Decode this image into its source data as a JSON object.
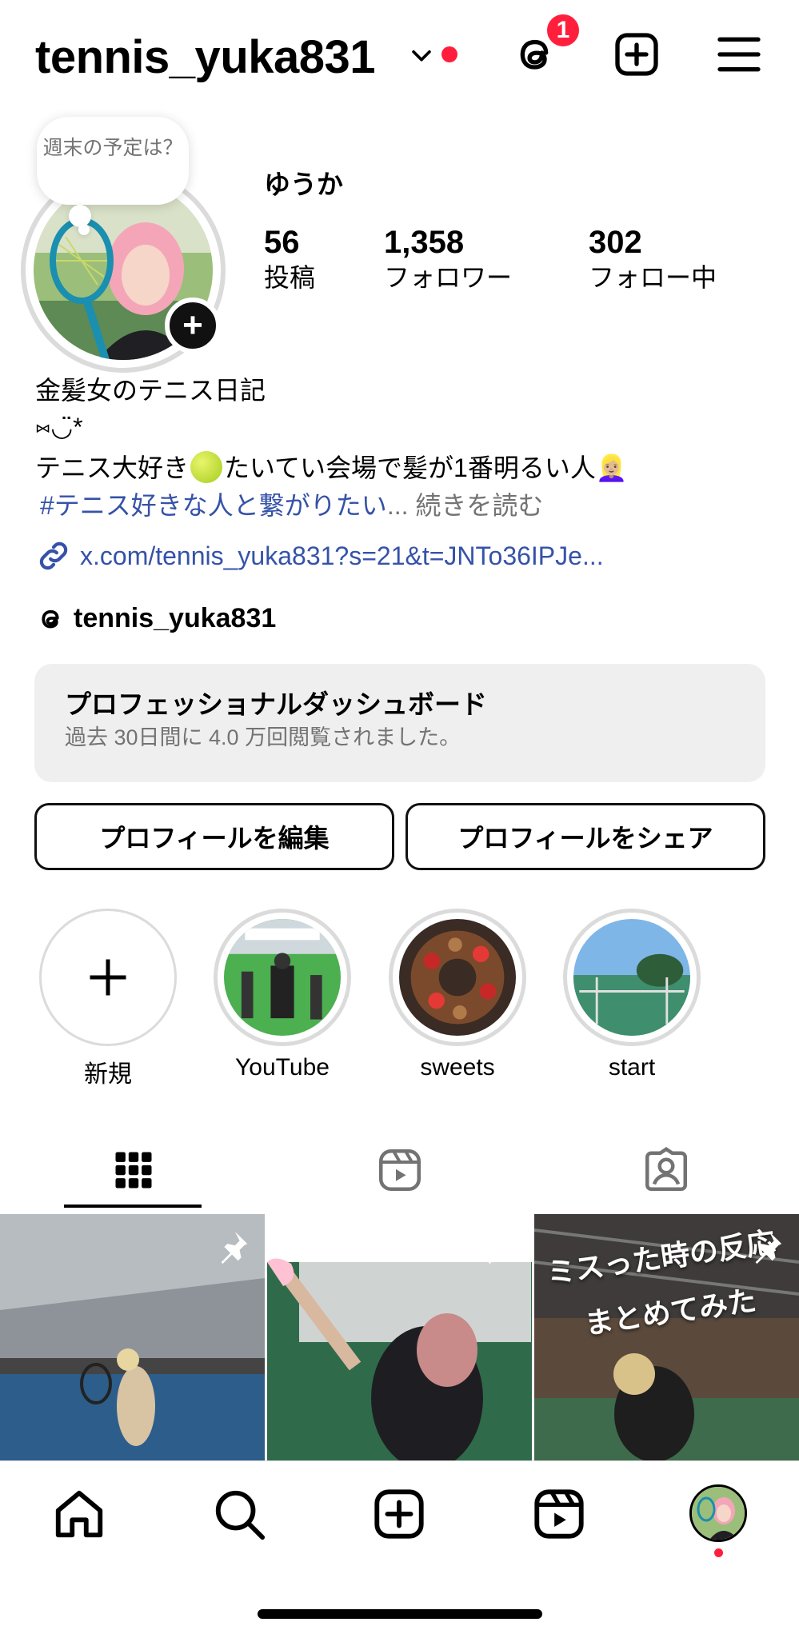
{
  "header": {
    "username": "tennis_yuka831",
    "threads_badge": "1"
  },
  "profile": {
    "note": "週末の予定は？",
    "display_name": "ゆうか",
    "stats": [
      {
        "value": "56",
        "label": "投稿"
      },
      {
        "value": "1,358",
        "label": "フォロワー"
      },
      {
        "value": "302",
        "label": "フォロー中"
      }
    ],
    "bio_line1": "金髪女のテニス日記",
    "bio_line2": "⑅◡̈*",
    "bio_line3a": "テニス大好き",
    "bio_line3b": "たいてい会場で髪が1番明るい人👱🏼‍♀️",
    "hashtag": "#テニス好きな人と繋がりたい",
    "ellipsis": "...",
    "read_more": "続きを読む",
    "link": "x.com/tennis_yuka831?s=21&t=JNTo36IPJe...",
    "threads_handle": "tennis_yuka831"
  },
  "dashboard": {
    "title": "プロフェッショナルダッシュボード",
    "subtitle": "過去 30日間に 4.0 万回閲覧されました。"
  },
  "buttons": {
    "edit": "プロフィールを編集",
    "share": "プロフィールをシェア"
  },
  "highlights": [
    {
      "label": "新規"
    },
    {
      "label": "YouTube"
    },
    {
      "label": "sweets"
    },
    {
      "label": "start"
    }
  ],
  "posts": {
    "post3_line1": "ミスった時の反応",
    "post3_line2": "まとめてみた"
  },
  "colors": {
    "accent_red": "#ff1f3d",
    "link_blue": "#3552a8",
    "muted": "#737373"
  }
}
